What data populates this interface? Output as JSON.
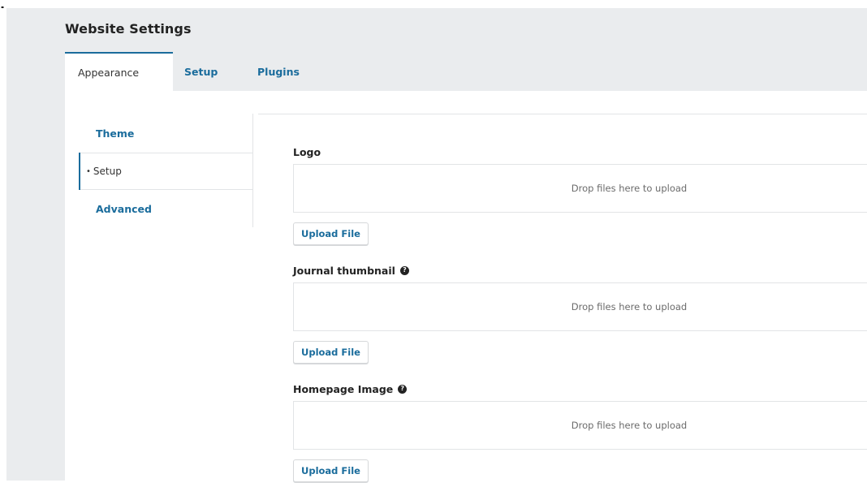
{
  "page": {
    "title": "Website Settings"
  },
  "tabs": [
    {
      "label": "Appearance",
      "active": true
    },
    {
      "label": "Setup",
      "active": false
    },
    {
      "label": "Plugins",
      "active": false
    }
  ],
  "sidebar": {
    "items": [
      {
        "label": "Theme",
        "current": false
      },
      {
        "label": "Setup",
        "current": true
      },
      {
        "label": "Advanced",
        "current": false
      }
    ]
  },
  "fields": [
    {
      "label": "Logo",
      "has_help": false,
      "dropzone_text": "Drop files here to upload",
      "upload_label": "Upload File"
    },
    {
      "label": "Journal thumbnail",
      "has_help": true,
      "dropzone_text": "Drop files here to upload",
      "upload_label": "Upload File"
    },
    {
      "label": "Homepage Image",
      "has_help": true,
      "dropzone_text": "Drop files here to upload",
      "upload_label": "Upload File"
    }
  ],
  "icons": {
    "help": "question-circle-icon",
    "bullet": "bullet-icon"
  },
  "colors": {
    "link": "#1a6c9c",
    "frame_background": "#eaecee",
    "panel_background": "#ffffff",
    "border": "#e2e4e6"
  }
}
